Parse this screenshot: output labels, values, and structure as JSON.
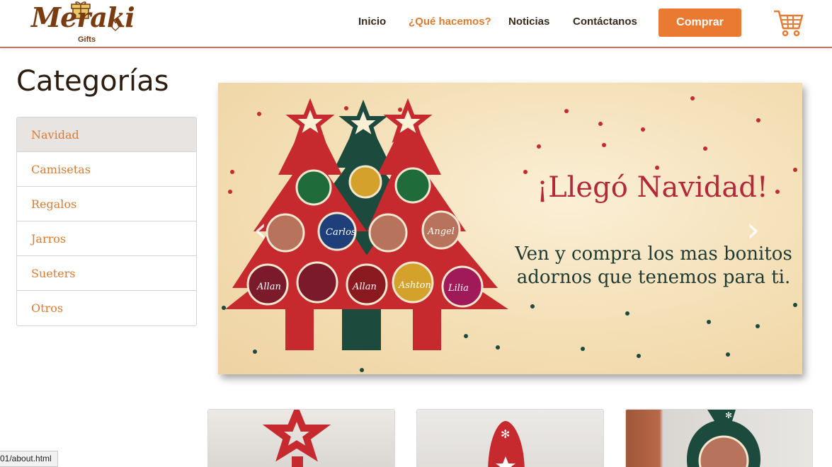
{
  "header": {
    "logo_text": "Meraki",
    "logo_sub": "Gifts",
    "nav": [
      {
        "label": "Inicio"
      },
      {
        "label": "¿Qué hacemos?"
      },
      {
        "label": "Noticias"
      },
      {
        "label": "Contáctanos"
      }
    ],
    "buy_label": "Comprar",
    "cart_icon": "shopping-cart-icon"
  },
  "sidebar": {
    "title": "Categorías",
    "items": [
      {
        "label": "Navidad"
      },
      {
        "label": "Camisetas"
      },
      {
        "label": "Regalos"
      },
      {
        "label": "Jarros"
      },
      {
        "label": "Sueters"
      },
      {
        "label": "Otros"
      }
    ]
  },
  "carousel": {
    "title": "¡Llegó Navidad!",
    "subtitle_line1": "Ven y compra los mas bonitos",
    "subtitle_line2": "adornos que tenemos para ti.",
    "ornaments": [
      "Allan",
      "Carlos",
      "Lilia",
      "Angel",
      "Ashton"
    ],
    "prev_icon": "chevron-left-icon",
    "next_icon": "chevron-right-icon"
  },
  "status_bar": {
    "url": "01/about.html"
  },
  "colors": {
    "accent": "#ea7a32",
    "brand": "#7a3b10",
    "slide_title": "#b5283a",
    "tree_red": "#c62a2f",
    "tree_green": "#1c4a3c"
  }
}
